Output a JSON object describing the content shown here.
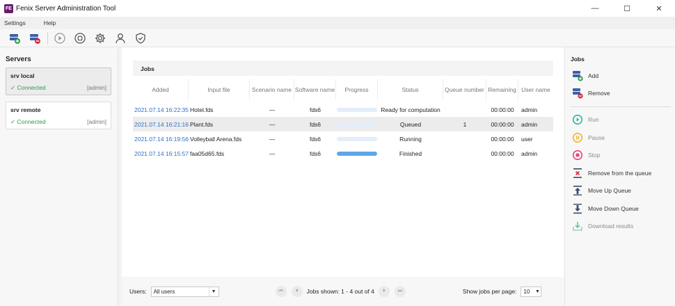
{
  "window": {
    "title": "Fenix Server Administration Tool",
    "icon_text": "FE",
    "controls": {
      "minimize": "—",
      "maximize": "☐",
      "close": "✕"
    }
  },
  "menu": {
    "items": [
      "Settings",
      "Help"
    ]
  },
  "toolbar": {
    "buttons": [
      "add-server-icon",
      "remove-server-icon",
      "run-icon",
      "stop-icon",
      "settings-icon",
      "user-icon",
      "shield-icon"
    ]
  },
  "servers": {
    "heading": "Servers",
    "items": [
      {
        "name": "srv local",
        "status": "✓ Connected",
        "role": "[admin]",
        "selected": true
      },
      {
        "name": "srv remote",
        "status": "✓ Connected",
        "role": "[admin]",
        "selected": false
      }
    ]
  },
  "jobs_table": {
    "heading": "Jobs",
    "columns": [
      "Added",
      "Input file",
      "Scenario name",
      "Software name",
      "Progress",
      "Status",
      "Queue number",
      "Remaining",
      "User name"
    ],
    "rows": [
      {
        "added": "2021.07.14 16:22:35",
        "file": "Hotel.fds",
        "scenario": "—",
        "software": "fds6",
        "progress": 0,
        "status": "Ready for computation",
        "queue": "",
        "remaining": "00:00:00",
        "user": "admin",
        "selected": false
      },
      {
        "added": "2021.07.14 16:21:16",
        "file": "Plant.fds",
        "scenario": "—",
        "software": "fds6",
        "progress": 0,
        "status": "Queued",
        "queue": "1",
        "remaining": "00:00:00",
        "user": "admin",
        "selected": true
      },
      {
        "added": "2021.07.14 16:19:56",
        "file": "Volleyball Arena.fds",
        "scenario": "—",
        "software": "fds6",
        "progress": 0,
        "status": "Running",
        "queue": "",
        "remaining": "00:00:00",
        "user": "user",
        "selected": false
      },
      {
        "added": "2021.07.14 16:15:57",
        "file": "faa05d65.fds",
        "scenario": "—",
        "software": "fds6",
        "progress": 1,
        "status": "Finished",
        "queue": "",
        "remaining": "00:00:00",
        "user": "admin",
        "selected": false
      }
    ]
  },
  "footer": {
    "users_label": "Users:",
    "users_value": "All users",
    "jobs_shown": "Jobs shown: 1 - 4 out of 4",
    "per_page_label": "Show jobs per page:",
    "per_page_value": "10",
    "pager": {
      "first": "⏮",
      "prev": "⏴",
      "next": "⏵",
      "last": "⏭"
    }
  },
  "actions": {
    "heading": "Jobs",
    "items": [
      {
        "label": "Add",
        "icon": "add-job-icon",
        "enabled": true
      },
      {
        "label": "Remove",
        "icon": "remove-job-icon",
        "enabled": true
      },
      {
        "label": "Run",
        "icon": "run-icon",
        "enabled": false
      },
      {
        "label": "Pause",
        "icon": "pause-icon",
        "enabled": false
      },
      {
        "label": "Stop",
        "icon": "stop-icon",
        "enabled": false
      },
      {
        "label": "Remove from the queue",
        "icon": "remove-from-queue-icon",
        "enabled": true
      },
      {
        "label": "Move Up Queue",
        "icon": "move-up-icon",
        "enabled": true
      },
      {
        "label": "Move Down Queue",
        "icon": "move-down-icon",
        "enabled": true
      },
      {
        "label": "Download results",
        "icon": "download-icon",
        "enabled": false
      }
    ]
  },
  "colors": {
    "accent": "#2f6fc9",
    "connected": "#2a9a4b",
    "run": "#2bb3a0",
    "pause": "#f0b429",
    "stop": "#e0457b",
    "remove": "#d42b3c",
    "progress": "#5da6e8"
  }
}
